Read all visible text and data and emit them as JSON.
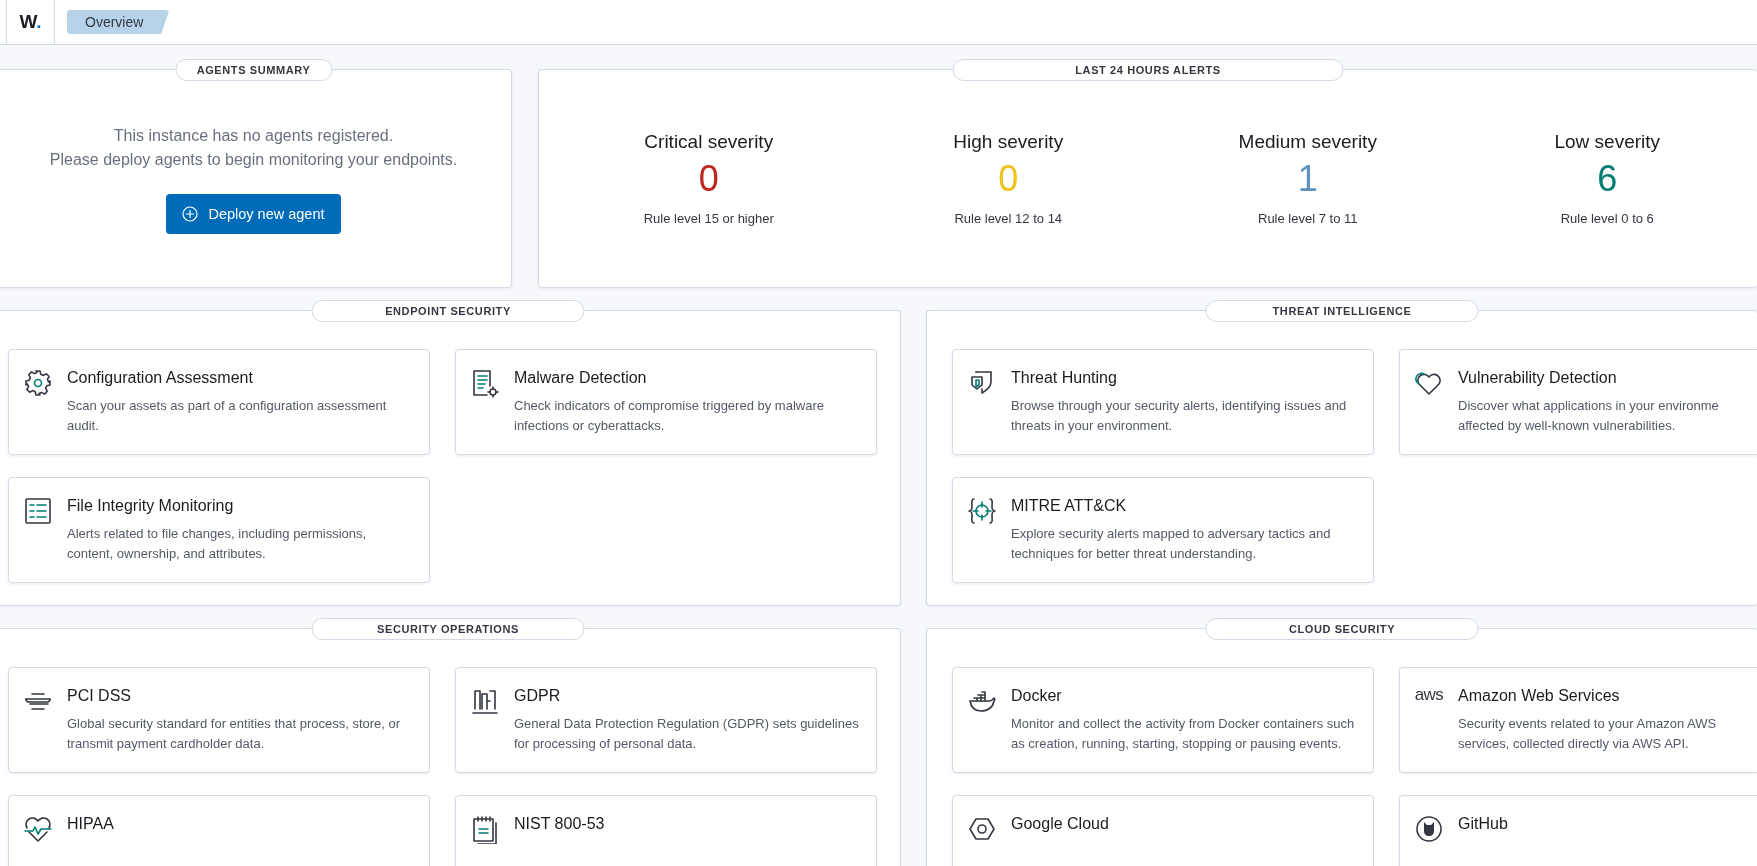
{
  "header": {
    "logo_letter": "W",
    "logo_dot": ".",
    "breadcrumb": "Overview"
  },
  "agents_summary": {
    "title": "AGENTS SUMMARY",
    "message": [
      "This instance has no agents registered.",
      "Please deploy agents to begin monitoring your endpoints."
    ],
    "button": "Deploy new agent"
  },
  "alerts": {
    "title": "LAST 24 HOURS ALERTS",
    "items": [
      {
        "label": "Critical severity",
        "count": "0",
        "rule": "Rule level 15 or higher",
        "color": "#bd271e"
      },
      {
        "label": "High severity",
        "count": "0",
        "rule": "Rule level 12 to 14",
        "color": "#f1c21b"
      },
      {
        "label": "Medium severity",
        "count": "1",
        "rule": "Rule level 7 to 11",
        "color": "#6092c0"
      },
      {
        "label": "Low severity",
        "count": "6",
        "rule": "Rule level 0 to 6",
        "color": "#017d73"
      }
    ]
  },
  "sections": [
    {
      "title": "ENDPOINT SECURITY",
      "cards": [
        {
          "title": "Configuration Assessment",
          "description": "Scan your assets as part of a configuration assessment audit."
        },
        {
          "title": "Malware Detection",
          "description": "Check indicators of compromise triggered by malware infections or cyberattacks."
        },
        {
          "title": "File Integrity Monitoring",
          "description": "Alerts related to file changes, including permissions, content, ownership, and attributes."
        }
      ]
    },
    {
      "title": "THREAT INTELLIGENCE",
      "cards": [
        {
          "title": "Threat Hunting",
          "description": "Browse through your security alerts, identifying issues and threats in your environment."
        },
        {
          "title": "Vulnerability Detection",
          "description": "Discover what applications in your environme affected by well-known vulnerabilities."
        },
        {
          "title": "MITRE ATT&CK",
          "description": "Explore security alerts mapped to adversary tactics and techniques for better threat understanding."
        }
      ]
    },
    {
      "title": "SECURITY OPERATIONS",
      "cards": [
        {
          "title": "PCI DSS",
          "description": "Global security standard for entities that process, store, or transmit payment cardholder data."
        },
        {
          "title": "GDPR",
          "description": "General Data Protection Regulation (GDPR) sets guidelines for processing of personal data."
        },
        {
          "title": "HIPAA"
        },
        {
          "title": "NIST 800-53"
        }
      ]
    },
    {
      "title": "CLOUD SECURITY",
      "cards": [
        {
          "title": "Docker",
          "description": "Monitor and collect the activity from Docker containers such as creation, running, starting, stopping or pausing events."
        },
        {
          "title": "Amazon Web Services",
          "icon_text": "aws",
          "description": "Security events related to your Amazon AWS services, collected directly via AWS API."
        },
        {
          "title": "Google Cloud"
        },
        {
          "title": "GitHub"
        }
      ]
    }
  ]
}
